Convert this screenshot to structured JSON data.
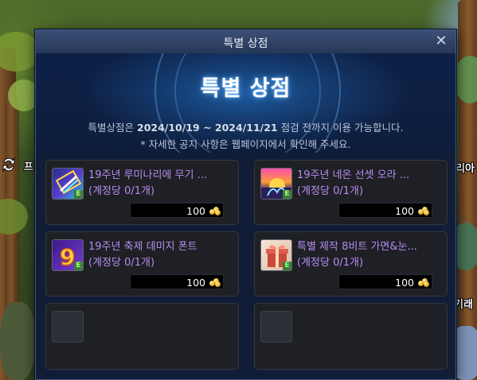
{
  "window": {
    "title": "특별 상점",
    "banner_title": "특별 상점",
    "notice_prefix": "특별상점은 ",
    "notice_period": "2024/10/19 ~ 2024/11/21",
    "notice_suffix": " 점검 전까지 이용 가능합니다.",
    "notice_line2": "* 자세한 공지 사항은 웹페이지에서 확인해 주세요."
  },
  "background": {
    "left_text": "프",
    "right_text1": "리아",
    "right_text2": "기래"
  },
  "items": [
    {
      "name": "19주년 루미나리에 무기 ...",
      "limit": "(계정당 0/1개)",
      "price": "100",
      "icon": "lumi-weapon-icon"
    },
    {
      "name": "19주년 네온 선셋 오라 ...",
      "limit": "(계정당 0/1개)",
      "price": "100",
      "icon": "neon-sunset-aura-icon"
    },
    {
      "name": "19주년 축제 데미지 폰트",
      "limit": "(계정당 0/1개)",
      "price": "100",
      "icon": "damage-font-icon"
    },
    {
      "name": "특별 제작 8비트 가면&눈...",
      "limit": "(계정당 0/1개)",
      "price": "100",
      "icon": "gift-box-icon"
    }
  ],
  "currency_icon": "coin-stack-icon",
  "colors": {
    "item_name": "#b88cf0",
    "window_bg": "#111d36",
    "banner_glow": "#5fb0ff"
  }
}
